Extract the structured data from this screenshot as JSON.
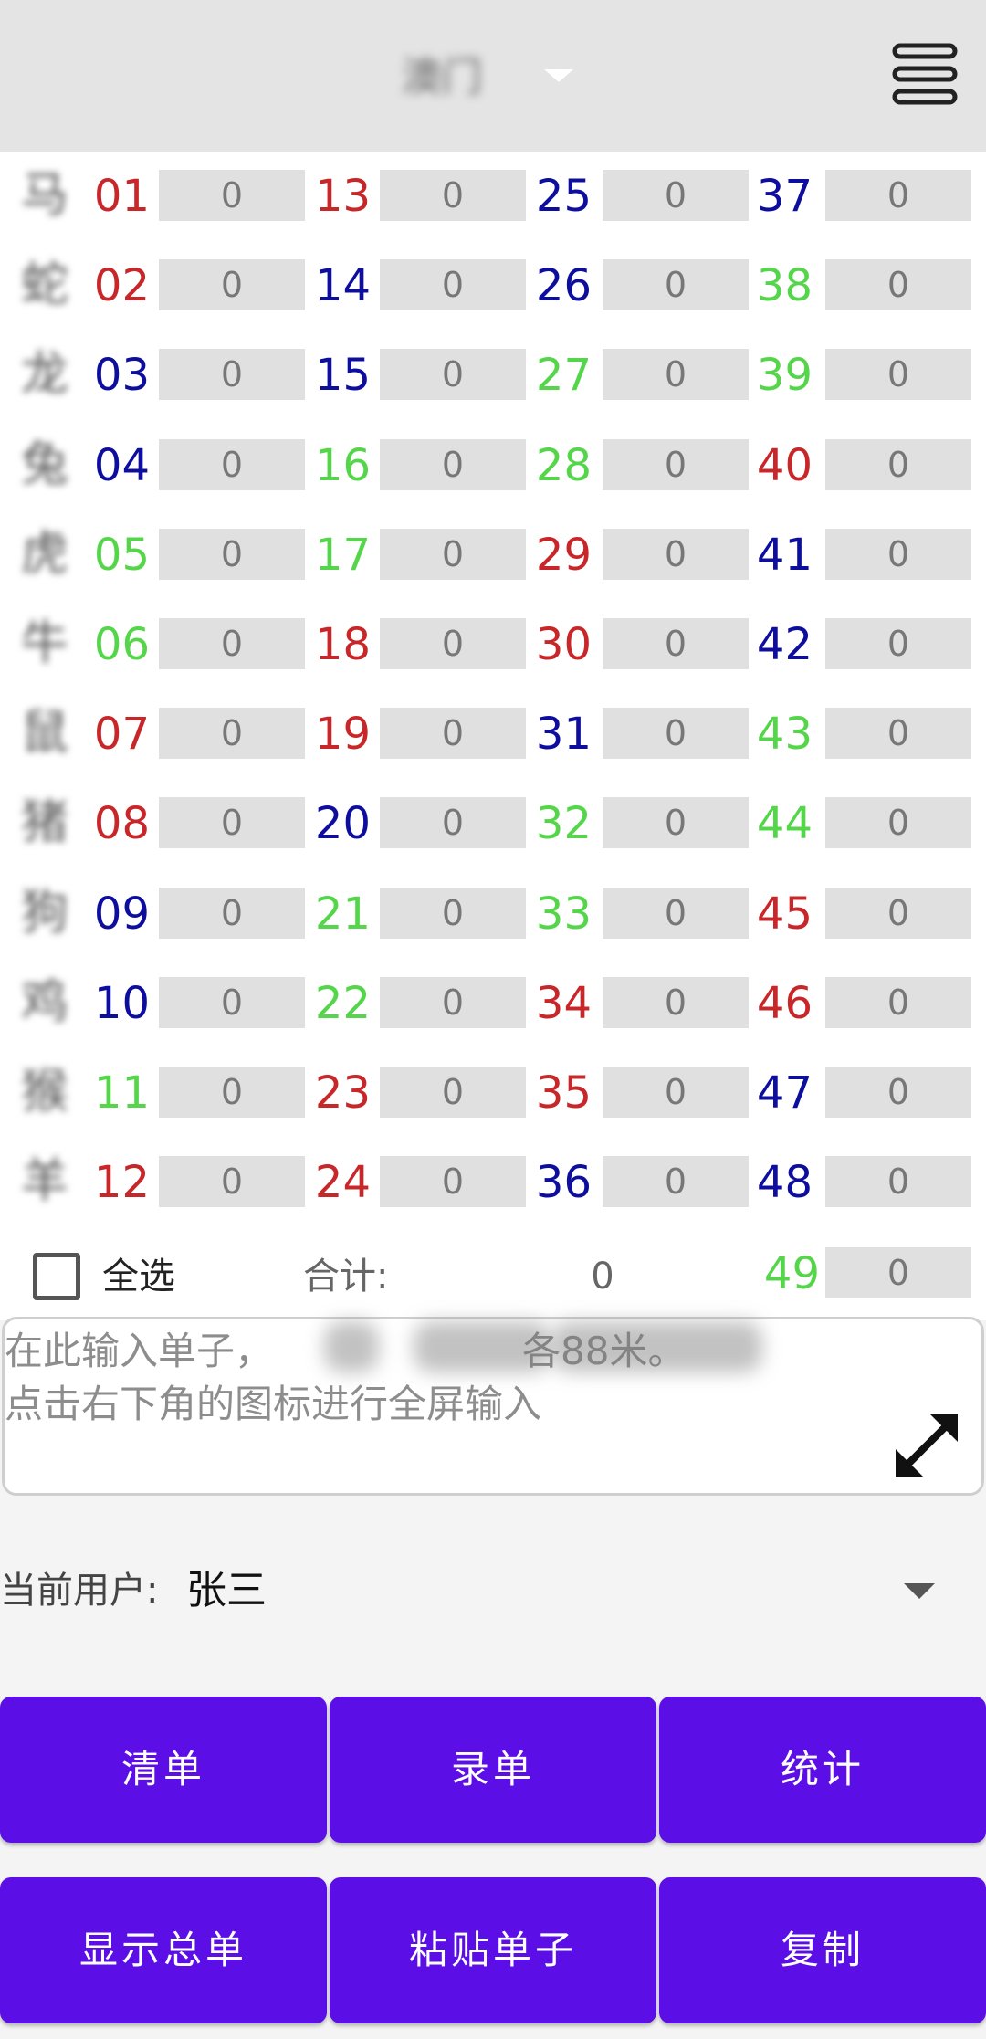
{
  "header": {
    "title": "澳门",
    "menu_icon": "hamburger-icon"
  },
  "colors": {
    "red": "#c8272a",
    "blue": "#0d0d9e",
    "green": "#55d64a",
    "button": "#5b0fe6"
  },
  "grid": {
    "rows": [
      {
        "zodiac": "马",
        "cells": [
          {
            "num": "01",
            "color": "red",
            "amount": "0"
          },
          {
            "num": "13",
            "color": "red",
            "amount": "0"
          },
          {
            "num": "25",
            "color": "blue",
            "amount": "0"
          },
          {
            "num": "37",
            "color": "blue",
            "amount": "0"
          }
        ]
      },
      {
        "zodiac": "蛇",
        "cells": [
          {
            "num": "02",
            "color": "red",
            "amount": "0"
          },
          {
            "num": "14",
            "color": "blue",
            "amount": "0"
          },
          {
            "num": "26",
            "color": "blue",
            "amount": "0"
          },
          {
            "num": "38",
            "color": "green",
            "amount": "0"
          }
        ]
      },
      {
        "zodiac": "龙",
        "cells": [
          {
            "num": "03",
            "color": "blue",
            "amount": "0"
          },
          {
            "num": "15",
            "color": "blue",
            "amount": "0"
          },
          {
            "num": "27",
            "color": "green",
            "amount": "0"
          },
          {
            "num": "39",
            "color": "green",
            "amount": "0"
          }
        ]
      },
      {
        "zodiac": "兔",
        "cells": [
          {
            "num": "04",
            "color": "blue",
            "amount": "0"
          },
          {
            "num": "16",
            "color": "green",
            "amount": "0"
          },
          {
            "num": "28",
            "color": "green",
            "amount": "0"
          },
          {
            "num": "40",
            "color": "red",
            "amount": "0"
          }
        ]
      },
      {
        "zodiac": "虎",
        "cells": [
          {
            "num": "05",
            "color": "green",
            "amount": "0"
          },
          {
            "num": "17",
            "color": "green",
            "amount": "0"
          },
          {
            "num": "29",
            "color": "red",
            "amount": "0"
          },
          {
            "num": "41",
            "color": "blue",
            "amount": "0"
          }
        ]
      },
      {
        "zodiac": "牛",
        "cells": [
          {
            "num": "06",
            "color": "green",
            "amount": "0"
          },
          {
            "num": "18",
            "color": "red",
            "amount": "0"
          },
          {
            "num": "30",
            "color": "red",
            "amount": "0"
          },
          {
            "num": "42",
            "color": "blue",
            "amount": "0"
          }
        ]
      },
      {
        "zodiac": "鼠",
        "cells": [
          {
            "num": "07",
            "color": "red",
            "amount": "0"
          },
          {
            "num": "19",
            "color": "red",
            "amount": "0"
          },
          {
            "num": "31",
            "color": "blue",
            "amount": "0"
          },
          {
            "num": "43",
            "color": "green",
            "amount": "0"
          }
        ]
      },
      {
        "zodiac": "猪",
        "cells": [
          {
            "num": "08",
            "color": "red",
            "amount": "0"
          },
          {
            "num": "20",
            "color": "blue",
            "amount": "0"
          },
          {
            "num": "32",
            "color": "green",
            "amount": "0"
          },
          {
            "num": "44",
            "color": "green",
            "amount": "0"
          }
        ]
      },
      {
        "zodiac": "狗",
        "cells": [
          {
            "num": "09",
            "color": "blue",
            "amount": "0"
          },
          {
            "num": "21",
            "color": "green",
            "amount": "0"
          },
          {
            "num": "33",
            "color": "green",
            "amount": "0"
          },
          {
            "num": "45",
            "color": "red",
            "amount": "0"
          }
        ]
      },
      {
        "zodiac": "鸡",
        "cells": [
          {
            "num": "10",
            "color": "blue",
            "amount": "0"
          },
          {
            "num": "22",
            "color": "green",
            "amount": "0"
          },
          {
            "num": "34",
            "color": "red",
            "amount": "0"
          },
          {
            "num": "46",
            "color": "red",
            "amount": "0"
          }
        ]
      },
      {
        "zodiac": "猴",
        "cells": [
          {
            "num": "11",
            "color": "green",
            "amount": "0"
          },
          {
            "num": "23",
            "color": "red",
            "amount": "0"
          },
          {
            "num": "35",
            "color": "red",
            "amount": "0"
          },
          {
            "num": "47",
            "color": "blue",
            "amount": "0"
          }
        ]
      },
      {
        "zodiac": "羊",
        "cells": [
          {
            "num": "12",
            "color": "red",
            "amount": "0"
          },
          {
            "num": "24",
            "color": "red",
            "amount": "0"
          },
          {
            "num": "36",
            "color": "blue",
            "amount": "0"
          },
          {
            "num": "48",
            "color": "blue",
            "amount": "0"
          }
        ]
      }
    ]
  },
  "summary": {
    "select_all_label": "全选",
    "select_all_checked": false,
    "total_label": "合计:",
    "total_value": "0",
    "extra_num": "49",
    "extra_color": "green",
    "extra_amount": "0"
  },
  "order_input": {
    "placeholder": "在此输入单子，　　　　　　　各88米。\n点击右下角的图标进行全屏输入",
    "value": "",
    "expand_icon": "expand-arrows-icon"
  },
  "user": {
    "label": "当前用户:",
    "value": "张三"
  },
  "buttons": {
    "clear": "清单",
    "record": "录单",
    "stats": "统计",
    "show_total": "显示总单",
    "paste": "粘贴单子",
    "copy": "复制"
  }
}
